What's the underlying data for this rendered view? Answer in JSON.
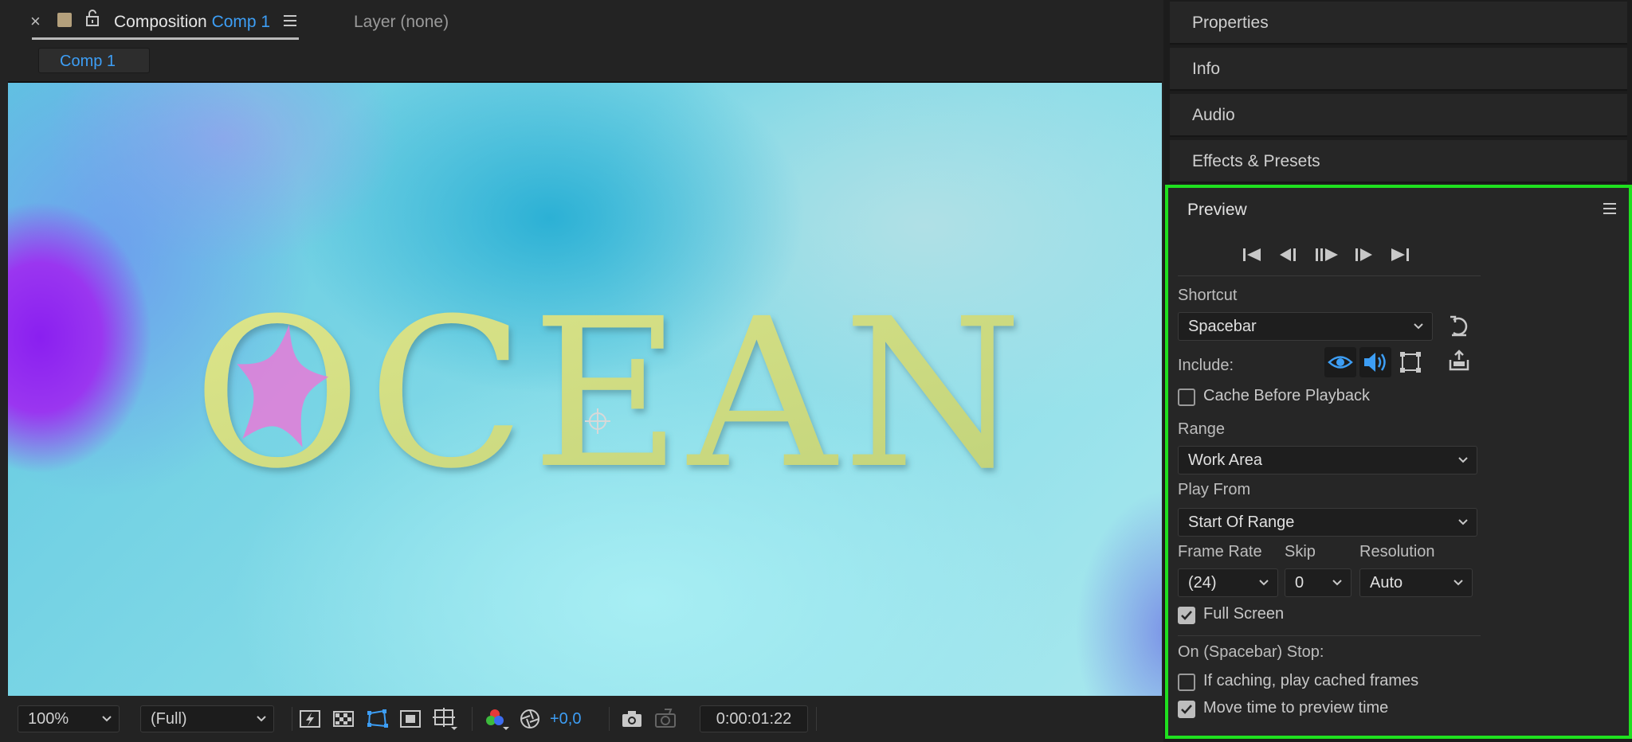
{
  "composition_tab": {
    "close_label": "×",
    "title_prefix": "Composition",
    "title_name": "Comp 1",
    "layer_tab": "Layer (none)",
    "breadcrumb": "Comp 1"
  },
  "viewer": {
    "canvas_text": "OCEAN"
  },
  "viewer_toolbar": {
    "magnification": "100%",
    "resolution": "(Full)",
    "exposure": "+0,0",
    "timecode": "0:00:01:22"
  },
  "right_panels": {
    "properties": "Properties",
    "info": "Info",
    "audio": "Audio",
    "effects": "Effects & Presets"
  },
  "preview": {
    "title": "Preview",
    "shortcut_label": "Shortcut",
    "shortcut_value": "Spacebar",
    "include_label": "Include:",
    "include_video": true,
    "include_audio": true,
    "include_overlays": false,
    "cache_before_playback": "Cache Before Playback",
    "cache_before_playback_checked": false,
    "range_label": "Range",
    "range_value": "Work Area",
    "play_from_label": "Play From",
    "play_from_value": "Start Of Range",
    "frame_rate_label": "Frame Rate",
    "frame_rate_value": "(24)",
    "skip_label": "Skip",
    "skip_value": "0",
    "resolution_label": "Resolution",
    "resolution_value": "Auto",
    "full_screen": "Full Screen",
    "full_screen_checked": true,
    "on_stop_label": "On (Spacebar) Stop:",
    "if_caching": "If caching, play cached frames",
    "if_caching_checked": false,
    "move_time": "Move time to preview time",
    "move_time_checked": true
  },
  "colors": {
    "accent_blue": "#3d9ef5",
    "highlight_border": "#1fe01f",
    "title_yellow_green": "#d9e47a",
    "starfish_pink": "#e07fd8"
  }
}
